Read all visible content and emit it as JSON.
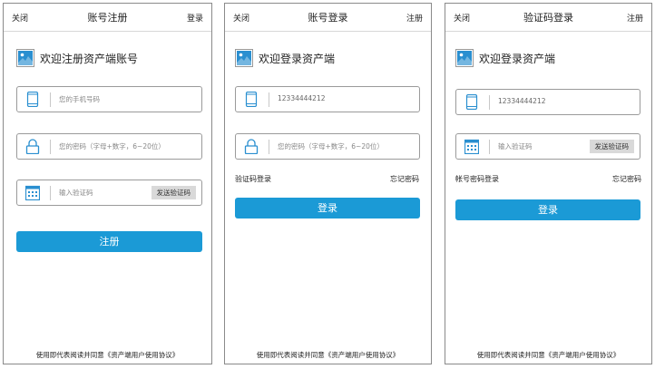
{
  "register": {
    "close": "关闭",
    "title": "账号注册",
    "login": "登录",
    "welcome": "欢迎注册资产端账号",
    "phone_placeholder": "您的手机号码",
    "password_placeholder": "您的密码（字母+数字，6~20位）",
    "code_placeholder": "输入验证码",
    "send_code": "发送验证码",
    "submit": "注册",
    "footer": "使用即代表阅读并同意《资产端用户使用协议》"
  },
  "account_login": {
    "close": "关闭",
    "title": "账号登录",
    "register": "注册",
    "welcome": "欢迎登录资产端",
    "phone_value": "12334444212",
    "password_placeholder": "您的密码（字母+数字，6~20位）",
    "code_login_link": "验证码登录",
    "forgot": "忘记密码",
    "submit": "登录",
    "footer": "使用即代表阅读并同意《资产端用户使用协议》"
  },
  "code_login": {
    "close": "关闭",
    "title": "验证码登录",
    "register": "注册",
    "welcome": "欢迎登录资产端",
    "phone_value": "12334444212",
    "code_placeholder": "输入验证码",
    "send_code": "发送验证码",
    "password_login_link": "帐号密码登录",
    "forgot": "忘记密码",
    "submit": "登录",
    "footer": "使用即代表阅读并同意《资产端用户使用协议》"
  },
  "colors": {
    "primary": "#1b9ad6",
    "icon": "#2a8fd0"
  }
}
